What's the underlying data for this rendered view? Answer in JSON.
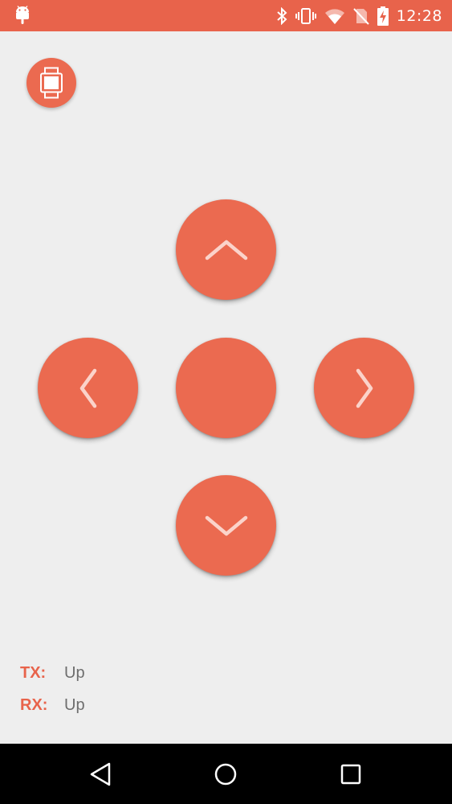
{
  "status_bar": {
    "time": "12:28",
    "icons": [
      "android-icon",
      "bluetooth-icon",
      "vibrate-icon",
      "wifi-icon",
      "no-sim-icon",
      "battery-charging-icon"
    ],
    "color": "#e8634b"
  },
  "device_button": {
    "icon": "watch-icon"
  },
  "dpad": {
    "up_icon": "chevron-up-icon",
    "left_icon": "chevron-left-icon",
    "right_icon": "chevron-right-icon",
    "down_icon": "chevron-down-icon",
    "button_color": "#eb6a50"
  },
  "readouts": {
    "tx_label": "TX:",
    "tx_value": "Up",
    "rx_label": "RX:",
    "rx_value": "Up"
  },
  "nav_bar": {
    "icons": [
      "back-icon",
      "home-icon",
      "recents-icon"
    ]
  }
}
